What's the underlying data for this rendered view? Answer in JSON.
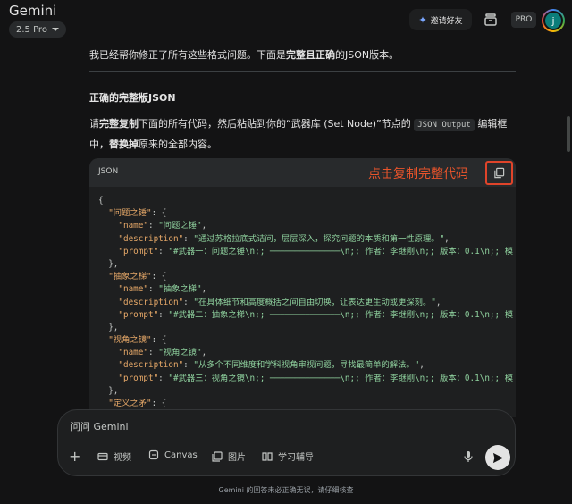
{
  "header": {
    "app_title": "Gemini",
    "model_label": "2.5 Pro",
    "invite_label": "邀请好友",
    "pro_label": "PRO",
    "avatar_initial": "j"
  },
  "message": {
    "intro": "我已经帮你修正了所有这些格式问题。下面是完整且正确的JSON版本。",
    "intro_parts": [
      "我已经帮你修正了所有这些格式问题。下面是",
      "完整且正确",
      "的JSON版本。"
    ],
    "heading": "正确的完整版JSON",
    "instr": [
      "请",
      "完整复制",
      "下面的所有代码，然后粘贴到你的“武器库 (Set Node)”节点的 ",
      "JSON Output",
      " 编辑框中，",
      "替换掉",
      "原来的全部内容。"
    ]
  },
  "code_block": {
    "language": "JSON",
    "annotation": "点击复制完整代码",
    "lines": [
      [
        {
          "t": "p",
          "v": "{"
        }
      ],
      [
        {
          "t": "p",
          "v": "  "
        },
        {
          "t": "k",
          "v": "\"问题之锤\""
        },
        {
          "t": "p",
          "v": ": {"
        }
      ],
      [
        {
          "t": "p",
          "v": "    "
        },
        {
          "t": "k",
          "v": "\"name\""
        },
        {
          "t": "p",
          "v": ": "
        },
        {
          "t": "s",
          "v": "\"问题之锤\""
        },
        {
          "t": "p",
          "v": ","
        }
      ],
      [
        {
          "t": "p",
          "v": "    "
        },
        {
          "t": "k",
          "v": "\"description\""
        },
        {
          "t": "p",
          "v": ": "
        },
        {
          "t": "s",
          "v": "\"通过苏格拉底式诘问，层层深入，探究问题的本质和第一性原理。\""
        },
        {
          "t": "p",
          "v": ","
        }
      ],
      [
        {
          "t": "p",
          "v": "    "
        },
        {
          "t": "k",
          "v": "\"prompt\""
        },
        {
          "t": "p",
          "v": ": "
        },
        {
          "t": "s",
          "v": "\"#武器一：问题之锤\\n;; ──────────────\\n;; 作者：李继刚\\n;; 版本：0.1\\n;; 模"
        }
      ],
      [
        {
          "t": "p",
          "v": "  },"
        }
      ],
      [
        {
          "t": "p",
          "v": "  "
        },
        {
          "t": "k",
          "v": "\"抽象之梯\""
        },
        {
          "t": "p",
          "v": ": {"
        }
      ],
      [
        {
          "t": "p",
          "v": "    "
        },
        {
          "t": "k",
          "v": "\"name\""
        },
        {
          "t": "p",
          "v": ": "
        },
        {
          "t": "s",
          "v": "\"抽象之梯\""
        },
        {
          "t": "p",
          "v": ","
        }
      ],
      [
        {
          "t": "p",
          "v": "    "
        },
        {
          "t": "k",
          "v": "\"description\""
        },
        {
          "t": "p",
          "v": ": "
        },
        {
          "t": "s",
          "v": "\"在具体细节和高度概括之间自由切换，让表达更生动或更深刻。\""
        },
        {
          "t": "p",
          "v": ","
        }
      ],
      [
        {
          "t": "p",
          "v": "    "
        },
        {
          "t": "k",
          "v": "\"prompt\""
        },
        {
          "t": "p",
          "v": ": "
        },
        {
          "t": "s",
          "v": "\"#武器二：抽象之梯\\n;; ──────────────\\n;; 作者：李继刚\\n;; 版本：0.1\\n;; 模"
        }
      ],
      [
        {
          "t": "p",
          "v": "  },"
        }
      ],
      [
        {
          "t": "p",
          "v": "  "
        },
        {
          "t": "k",
          "v": "\"视角之镜\""
        },
        {
          "t": "p",
          "v": ": {"
        }
      ],
      [
        {
          "t": "p",
          "v": "    "
        },
        {
          "t": "k",
          "v": "\"name\""
        },
        {
          "t": "p",
          "v": ": "
        },
        {
          "t": "s",
          "v": "\"视角之镜\""
        },
        {
          "t": "p",
          "v": ","
        }
      ],
      [
        {
          "t": "p",
          "v": "    "
        },
        {
          "t": "k",
          "v": "\"description\""
        },
        {
          "t": "p",
          "v": ": "
        },
        {
          "t": "s",
          "v": "\"从多个不同维度和学科视角审视问题，寻找最简单的解法。\""
        },
        {
          "t": "p",
          "v": ","
        }
      ],
      [
        {
          "t": "p",
          "v": "    "
        },
        {
          "t": "k",
          "v": "\"prompt\""
        },
        {
          "t": "p",
          "v": ": "
        },
        {
          "t": "s",
          "v": "\"#武器三：视角之镜\\n;; ──────────────\\n;; 作者：李继刚\\n;; 版本：0.1\\n;; 模"
        }
      ],
      [
        {
          "t": "p",
          "v": "  },"
        }
      ],
      [
        {
          "t": "p",
          "v": "  "
        },
        {
          "t": "k",
          "v": "\"定义之矛\""
        },
        {
          "t": "p",
          "v": ": {"
        }
      ]
    ]
  },
  "composer": {
    "placeholder": "问问 Gemini",
    "tools": [
      "视频",
      "Canvas",
      "图片",
      "学习辅导"
    ]
  },
  "footer": {
    "disclaimer": "Gemini 的回答未必正确无误，请仔细核查"
  }
}
